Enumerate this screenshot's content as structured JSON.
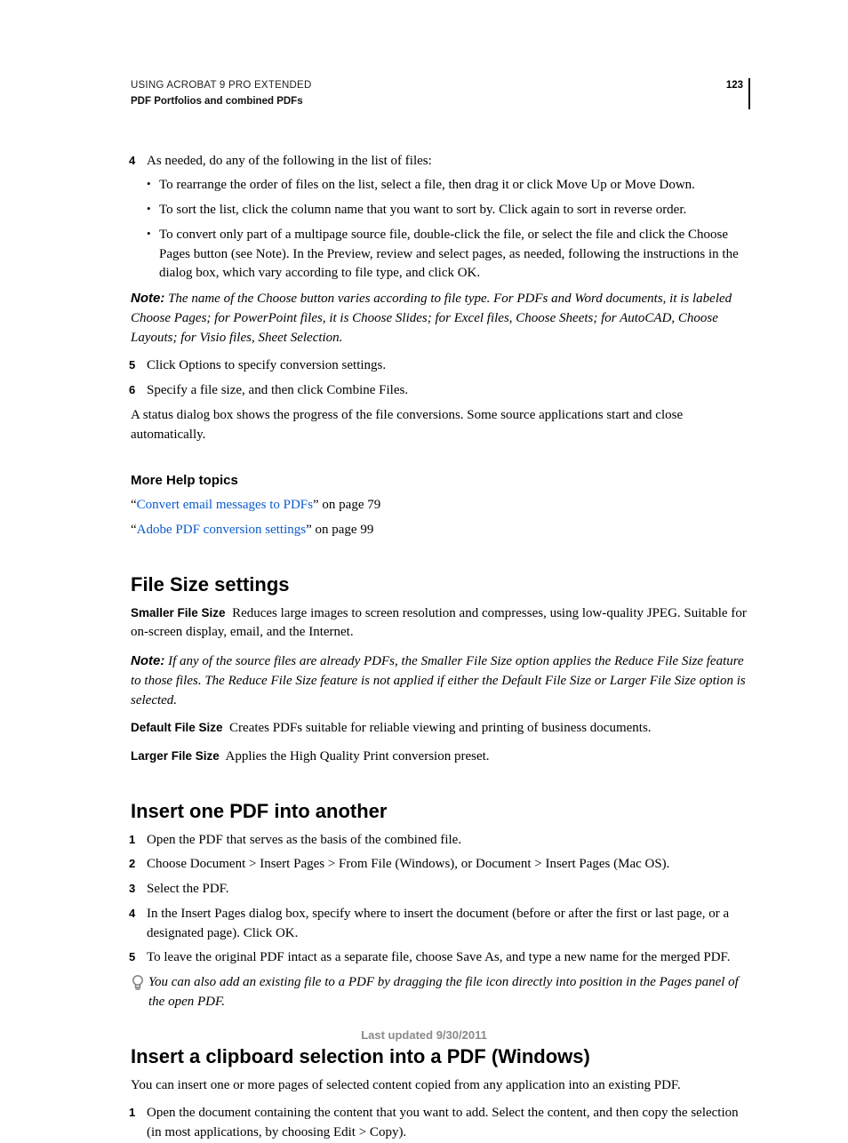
{
  "header": {
    "top": "USING ACROBAT 9 PRO EXTENDED",
    "section": "PDF Portfolios and combined PDFs",
    "page_number": "123"
  },
  "step4": {
    "num": "4",
    "text": "As needed, do any of the following in the list of files:"
  },
  "bullets1": [
    "To rearrange the order of files on the list, select a file, then drag it or click Move Up or Move Down.",
    "To sort the list, click the column name that you want to sort by. Click again to sort in reverse order.",
    "To convert only part of a multipage source file, double-click the file, or select the file and click the Choose Pages button (see Note). In the Preview, review and select pages, as needed, following the instructions in the dialog box, which vary according to file type, and click OK."
  ],
  "note1": {
    "label": "Note:",
    "text": "The name of the Choose button varies according to file type. For PDFs and Word documents, it is labeled Choose Pages; for PowerPoint files, it is Choose Slides; for Excel files, Choose Sheets; for AutoCAD, Choose Layouts; for Visio files, Sheet Selection."
  },
  "step5": {
    "num": "5",
    "text": "Click Options to specify conversion settings."
  },
  "step6": {
    "num": "6",
    "text": "Specify a file size, and then click Combine Files."
  },
  "para_status": "A status dialog box shows the progress of the file conversions. Some source applications start and close automatically.",
  "help": {
    "heading": "More Help topics",
    "ref1_link": "Convert email messages to PDFs",
    "ref1_suffix": "” on page 79",
    "ref2_link": "Adobe PDF conversion settings",
    "ref2_suffix": "” on page 99"
  },
  "sec_filesize": {
    "heading": "File Size settings",
    "smaller_label": "Smaller File Size",
    "smaller_text": "Reduces large images to screen resolution and compresses, using low-quality JPEG. Suitable for on-screen display, email, and the Internet.",
    "note_label": "Note:",
    "note_text": "If any of the source files are already PDFs, the Smaller File Size option applies the Reduce File Size feature to those files. The Reduce File Size feature is not applied if either the Default File Size or Larger File Size option is selected.",
    "default_label": "Default File Size",
    "default_text": "Creates PDFs suitable for reliable viewing and printing of business documents.",
    "larger_label": "Larger File Size",
    "larger_text": "Applies the High Quality Print conversion preset."
  },
  "sec_insert_pdf": {
    "heading": "Insert one PDF into another",
    "steps": [
      {
        "num": "1",
        "text": "Open the PDF that serves as the basis of the combined file."
      },
      {
        "num": "2",
        "text": "Choose Document > Insert Pages > From File (Windows), or Document > Insert Pages (Mac OS)."
      },
      {
        "num": "3",
        "text": "Select the PDF."
      },
      {
        "num": "4",
        "text": "In the Insert Pages dialog box, specify where to insert the document (before or after the first or last page, or a designated page). Click OK."
      },
      {
        "num": "5",
        "text": "To leave the original PDF intact as a separate file, choose Save As, and type a new name for the merged PDF."
      }
    ],
    "tip": "You can also add an existing file to a PDF by dragging the file icon directly into position in the Pages panel of the open PDF."
  },
  "sec_clipboard": {
    "heading": "Insert a clipboard selection into a PDF (Windows)",
    "intro": "You can insert one or more pages of selected content copied from any application into an existing PDF.",
    "steps": [
      {
        "num": "1",
        "text": "Open the document containing the content that you want to add. Select the content, and then copy the selection (in most applications, by choosing Edit > Copy)."
      }
    ]
  },
  "footer": "Last updated 9/30/2011"
}
